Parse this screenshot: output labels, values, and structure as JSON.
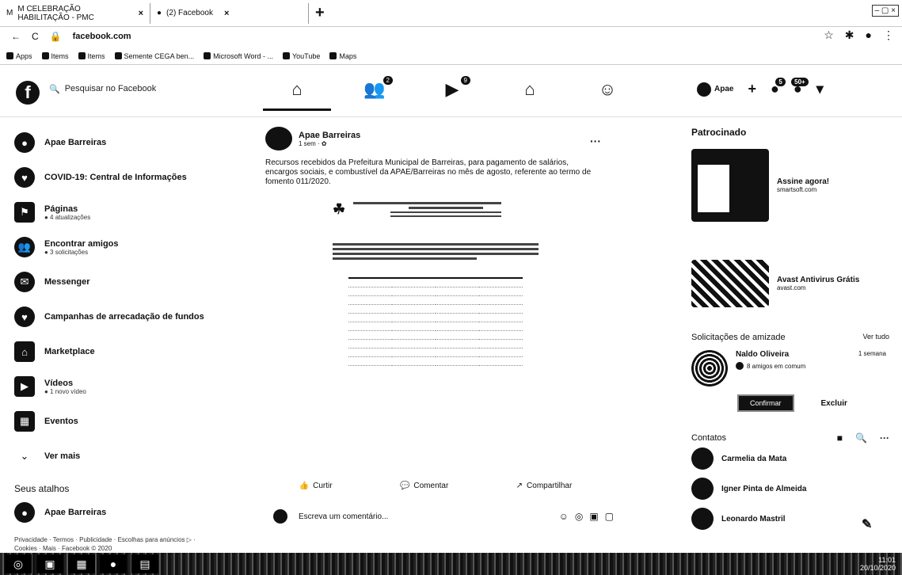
{
  "browser": {
    "tabs": [
      {
        "icon": "gmail-icon",
        "title": "M CELEBRAÇÃO HABILITAÇÃO - PMC"
      },
      {
        "icon": "facebook-icon",
        "title": "(2) Facebook"
      }
    ],
    "new_tab": "+",
    "url": "facebook.com",
    "bookmarks": [
      {
        "label": "Apps"
      },
      {
        "label": "Items"
      },
      {
        "label": "Items"
      },
      {
        "label": "Semente CEGA ben..."
      },
      {
        "label": "Microsoft Word - ..."
      },
      {
        "label": "YouTube"
      },
      {
        "label": "Maps"
      }
    ]
  },
  "header": {
    "search_placeholder": "Pesquisar no Facebook",
    "nav": [
      {
        "icon": "home-icon",
        "badge": ""
      },
      {
        "icon": "friends-icon",
        "badge": "2"
      },
      {
        "icon": "watch-icon",
        "badge": "9"
      },
      {
        "icon": "marketplace-icon",
        "badge": ""
      },
      {
        "icon": "groups-icon",
        "badge": ""
      }
    ],
    "profile_name": "Apae",
    "notif_badge": "5",
    "messages_badge": "50+"
  },
  "sidebar": {
    "items": [
      {
        "label": "Apae Barreiras",
        "sub": "",
        "icon": "avatar-icon"
      },
      {
        "label": "COVID-19: Central de Informações",
        "sub": "",
        "icon": "covid-info-icon"
      },
      {
        "label": "Páginas",
        "sub": "● 4 atualizações",
        "icon": "pages-icon"
      },
      {
        "label": "Encontrar amigos",
        "sub": "● 3 solicitações",
        "icon": "find-friends-icon"
      },
      {
        "label": "Messenger",
        "sub": "",
        "icon": "messenger-icon"
      },
      {
        "label": "Campanhas de arrecadação de fundos",
        "sub": "",
        "icon": "fundraiser-icon"
      },
      {
        "label": "Marketplace",
        "sub": "",
        "icon": "marketplace-icon"
      },
      {
        "label": "Vídeos",
        "sub": "● 1 novo vídeo",
        "icon": "video-icon"
      },
      {
        "label": "Eventos",
        "sub": "",
        "icon": "events-icon"
      },
      {
        "label": "Ver mais",
        "sub": "",
        "icon": "chevron-down-icon"
      }
    ],
    "shortcuts_title": "Seus atalhos",
    "shortcut": "Apae Barreiras",
    "footer": "Privacidade · Termos · Publicidade · Escolhas para anúncios ▷ · Cookies · Mais · Facebook © 2020"
  },
  "post": {
    "author": "Apae Barreiras",
    "meta": "1 sem · ✿",
    "text": "Recursos recebidos da Prefeitura Municipal de Barreiras, para pagamento de salários, encargos sociais, e combustível da APAE/Barreiras no mês de agosto, referente ao termo de fomento 011/2020.",
    "actions": {
      "like": "Curtir",
      "comment": "Comentar",
      "share": "Compartilhar"
    },
    "comment_placeholder": "Escreva um comentário..."
  },
  "right": {
    "sponsored_title": "Patrocinado",
    "ads": [
      {
        "title": "Assine agora!",
        "sub": "smartsoft.com"
      },
      {
        "title": "Avast Antivirus Grátis",
        "sub": "avast.com"
      }
    ],
    "friend_requests_title": "Solicitações de amizade",
    "see_all": "Ver tudo",
    "friend": {
      "name": "Naldo Oliveira",
      "time": "1 semana",
      "mutual": "8 amigos em comum",
      "confirm": "Confirmar",
      "delete": "Excluir"
    },
    "contacts_title": "Contatos",
    "contacts": [
      {
        "name": "Carmelia da Mata"
      },
      {
        "name": "Igner Pinta de Almeida"
      },
      {
        "name": "Leonardo Mastril"
      }
    ]
  },
  "taskbar": {
    "time": "11:01",
    "date": "20/10/2020"
  }
}
